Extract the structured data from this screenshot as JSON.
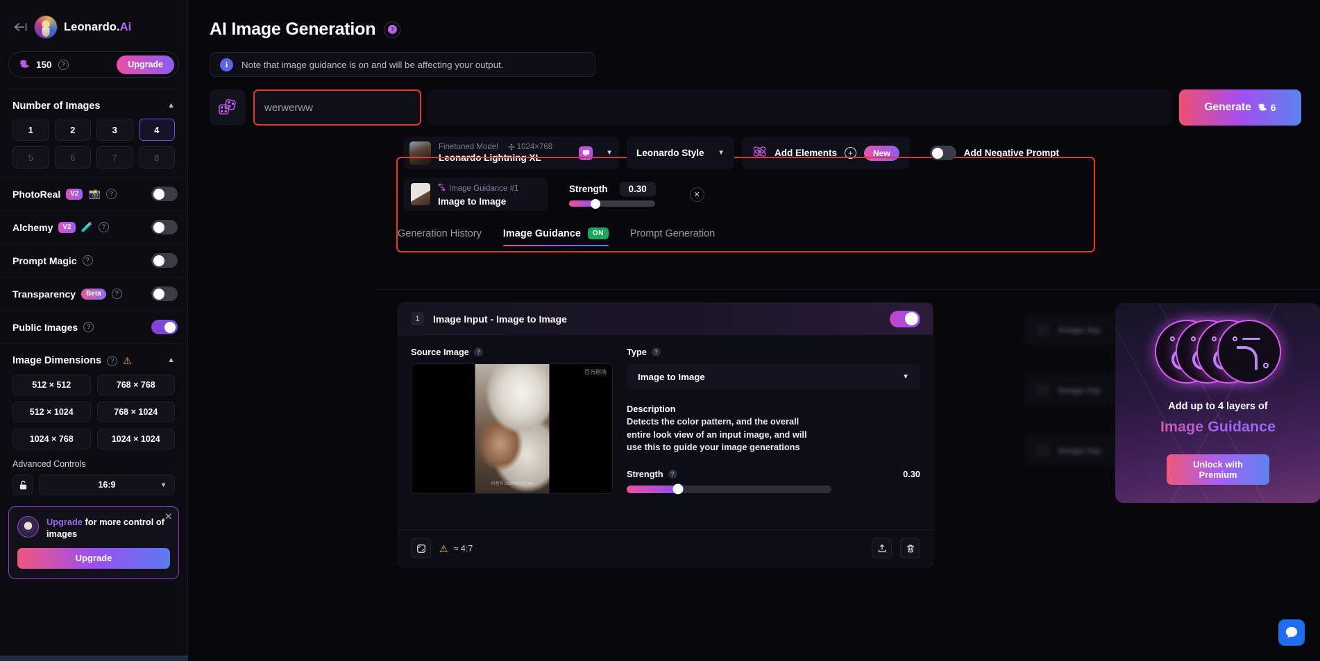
{
  "sidebar": {
    "brand": {
      "name": "Leonardo.",
      "suffix": "Ai",
      "back_icon": "back-arrow-icon"
    },
    "credits": {
      "value": "150",
      "help": "?",
      "upgrade_label": "Upgrade"
    },
    "number_of_images": {
      "title": "Number of Images",
      "options": [
        "1",
        "2",
        "3",
        "4",
        "5",
        "6",
        "7",
        "8"
      ],
      "selected": "4",
      "enabled_max": 4
    },
    "toggles": [
      {
        "label": "PhotoReal",
        "badge": "V2",
        "emoji": "📸",
        "help": "?",
        "on": false
      },
      {
        "label": "Alchemy",
        "badge": "V2",
        "emoji": "🧪",
        "help": "?",
        "on": false
      },
      {
        "label": "Prompt Magic",
        "badge": "",
        "emoji": "",
        "help": "?",
        "on": false
      },
      {
        "label": "Transparency",
        "badge": "Beta",
        "emoji": "",
        "help": "?",
        "on": false
      },
      {
        "label": "Public Images",
        "badge": "",
        "emoji": "",
        "help": "?",
        "on": true
      }
    ],
    "dimensions": {
      "title": "Image Dimensions",
      "help": "?",
      "warning_icon": "warning-triangle-icon",
      "options": [
        "512 × 512",
        "768 × 768",
        "512 × 1024",
        "768 × 1024",
        "1024 × 768",
        "1024 × 1024"
      ]
    },
    "advanced": {
      "label": "Advanced Controls",
      "lock_icon": "unlock-icon",
      "aspect_ratio": "16:9"
    },
    "upsell": {
      "highlight": "Upgrade",
      "text": " for more control of images",
      "button": "Upgrade",
      "close": "✕"
    }
  },
  "main": {
    "title": "AI Image Generation",
    "title_help": "?",
    "notice": "Note that image guidance is on and will be affecting your output.",
    "prompt": {
      "value": "werwerww",
      "placeholder": ""
    },
    "generate": {
      "label": "Generate",
      "cost": "6"
    },
    "model": {
      "kind": "Finetuned Model",
      "dimensions": "1024×768",
      "name": "Leonardo Lightning XL"
    },
    "style": "Leonardo Style",
    "elements": {
      "label": "Add Elements",
      "badge": "New"
    },
    "negative_prompt": {
      "label": "Add Negative Prompt",
      "on": false
    },
    "guidance_chip": {
      "kind": "Image Guidance #1",
      "name": "Image to Image",
      "strength_label": "Strength",
      "strength_value": "0.30",
      "close": "✕"
    },
    "tabs": [
      {
        "label": "Generation History",
        "active": false
      },
      {
        "label": "Image Guidance",
        "active": true,
        "badge": "ON"
      },
      {
        "label": "Prompt Generation",
        "active": false
      }
    ],
    "image_input": {
      "number": "1",
      "title": "Image Input - Image to Image",
      "enabled": true,
      "source_label": "Source Image",
      "source_help": "?",
      "source_watermark_top": "百万剧场",
      "source_watermark_bottom": "抖音号:339648763249",
      "type_label": "Type",
      "type_help": "?",
      "type_value": "Image to Image",
      "description_title": "Description",
      "description_body": "Detects the color pattern, and the overall entire look view of an input image, and will use this to guide your image generations",
      "strength_label": "Strength",
      "strength_help": "?",
      "strength_value": "0.30",
      "footer": {
        "fit_icon": "crop-icon",
        "warn_icon": "warning-triangle-icon",
        "ratio": "≈ 4:7",
        "upload_icon": "upload-icon",
        "delete_icon": "trash-icon"
      }
    },
    "blurred_rows": [
      {
        "title": "Image Inp"
      },
      {
        "title": "Image Inp"
      },
      {
        "title": "Image Inp"
      }
    ],
    "premium": {
      "line1": "Add up to 4 layers of",
      "line2": "Image Guidance",
      "button": "Unlock with Premium"
    },
    "chat_icon": "chat-bubble-icon"
  },
  "colors": {
    "accent_pink": "#ea4fa7",
    "accent_purple": "#8a5cf0",
    "accent_blue": "#5b83f0",
    "highlight_red": "#e8352c",
    "on_green": "#17a85a",
    "warning_amber": "#f2b42c"
  }
}
